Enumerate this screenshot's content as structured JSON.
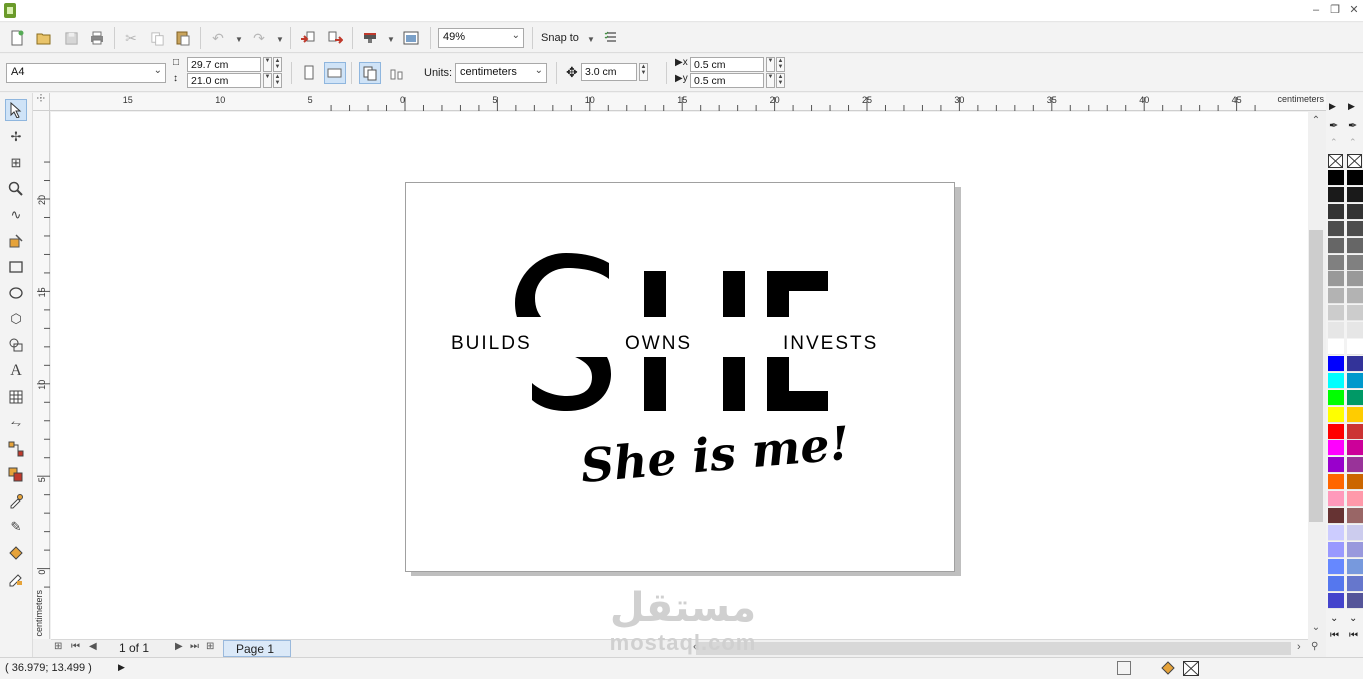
{
  "toolbar": {
    "zoom": "49%",
    "snap_label": "Snap to"
  },
  "property_bar": {
    "paper_size": "A4",
    "width": "29.7 cm",
    "height": "21.0 cm",
    "units_label": "Units:",
    "units": "centimeters",
    "nudge": "3.0 cm",
    "dup_x": "0.5 cm",
    "dup_y": "0.5 cm"
  },
  "ruler": {
    "h_labels": [
      "15",
      "10",
      "5",
      "0",
      "5",
      "10",
      "15",
      "20",
      "25",
      "30",
      "35",
      "40",
      "45"
    ],
    "h_unit": "centimeters",
    "v_labels": [
      "20",
      "15",
      "10",
      "5",
      "0"
    ],
    "v_unit": "centimeters"
  },
  "design": {
    "big_word": "SHE",
    "words": [
      "BUILDS",
      "OWNS",
      "INVESTS"
    ],
    "tagline": "She is me!"
  },
  "page_nav": {
    "counter": "1 of 1",
    "tab": "Page 1"
  },
  "status": {
    "coords": "( 36.979; 13.499 )"
  },
  "palette_colors": [
    "#000000",
    "#1a1a1a",
    "#333333",
    "#4d4d4d",
    "#666666",
    "#808080",
    "#999999",
    "#b3b3b3",
    "#cccccc",
    "#e6e6e6",
    "#ffffff",
    "#0000ff",
    "#00ffff",
    "#00ff00",
    "#ffff00",
    "#ff0000",
    "#ff00ff",
    "#9900cc",
    "#ff6600",
    "#ff99bb",
    "#663333",
    "#ccccff",
    "#9999ff",
    "#6688ff",
    "#5577ee",
    "#4444cc"
  ],
  "palette_colors_2": [
    "#000000",
    "#1a1a1a",
    "#333333",
    "#4d4d4d",
    "#666666",
    "#808080",
    "#999999",
    "#b3b3b3",
    "#cccccc",
    "#e6e6e6",
    "#ffffff",
    "#333399",
    "#0099cc",
    "#009966",
    "#ffcc00",
    "#cc3333",
    "#cc0099",
    "#993399",
    "#cc6600",
    "#ff99aa",
    "#996666",
    "#ccccee",
    "#9999dd",
    "#7799dd",
    "#6677cc",
    "#555599"
  ],
  "watermark": {
    "arabic": "مستقل",
    "latin": "mostaql.com"
  }
}
